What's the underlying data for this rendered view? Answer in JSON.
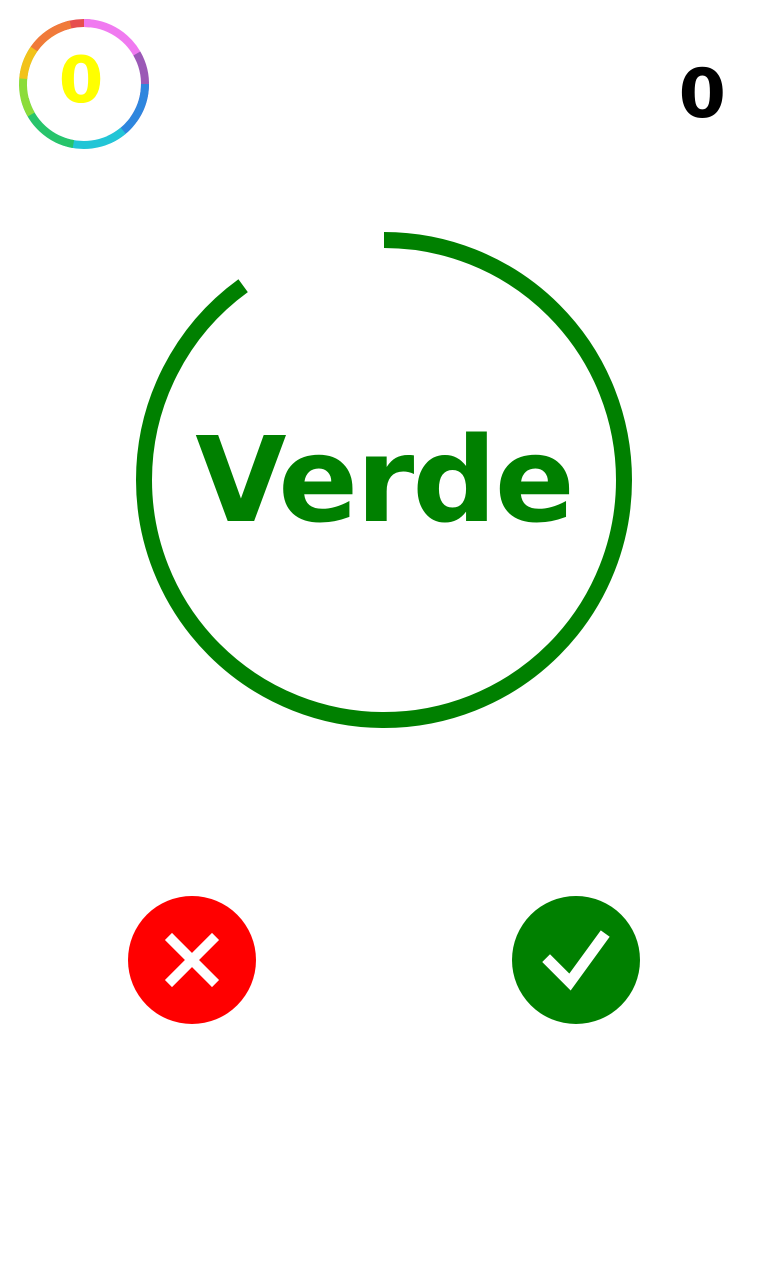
{
  "badge": {
    "value": "0",
    "value_color": "#ffff00"
  },
  "score": {
    "value": "0"
  },
  "timer": {
    "word": "Verde",
    "word_color": "#008000",
    "ring_color": "#008000",
    "remaining_fraction": 0.9
  },
  "buttons": {
    "no": {
      "icon": "cross-icon",
      "color": "#ff0000"
    },
    "yes": {
      "icon": "check-icon",
      "color": "#008000"
    }
  }
}
